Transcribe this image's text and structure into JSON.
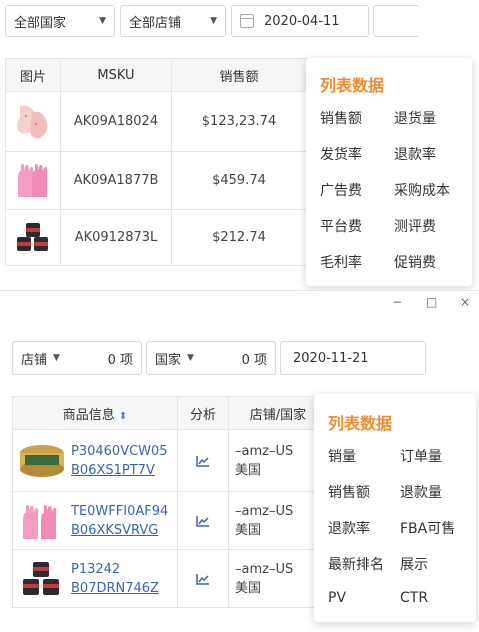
{
  "top": {
    "filters": {
      "country": "全部国家",
      "store": "全部店铺",
      "date": "2020-04-11"
    },
    "table": {
      "headers": [
        "图片",
        "MSKU",
        "销售额"
      ],
      "rows": [
        {
          "msku": "AK09A18024",
          "sales": "$123,23.74"
        },
        {
          "msku": "AK09A1877B",
          "sales": "$459.74"
        },
        {
          "msku": "AK0912873L",
          "sales": "$212.74"
        }
      ]
    },
    "panel": {
      "title": "列表数据",
      "options": [
        "销售额",
        "退货量",
        "发货率",
        "退款率",
        "广告费",
        "采购成本",
        "平台费",
        "测评费",
        "毛利率",
        "促销费"
      ]
    }
  },
  "window": {
    "controls": [
      "−",
      "□",
      "×"
    ]
  },
  "bottom": {
    "filters": {
      "store_label": "店铺",
      "store_count": "0 项",
      "country_label": "国家",
      "country_count": "0 项",
      "date": "2020-11-21"
    },
    "table": {
      "headers": [
        "商品信息",
        "分析",
        "店铺/国家"
      ],
      "rows": [
        {
          "code": "P30460VCW05",
          "asin": "B06XS1PT7V",
          "store": "–amz–US",
          "country": "美国"
        },
        {
          "code": "TE0WFFI0AF94",
          "asin": "B06XKSVRVG",
          "store": "–amz–US",
          "country": "美国"
        },
        {
          "code": "P13242",
          "asin": "B07DRN746Z",
          "store": "–amz–US",
          "country": "美国"
        }
      ]
    },
    "panel": {
      "title": "列表数据",
      "options": [
        "销量",
        "订单量",
        "销售额",
        "退款量",
        "退款率",
        "FBA可售",
        "最新排名",
        "展示",
        "PV",
        "CTR"
      ]
    }
  }
}
